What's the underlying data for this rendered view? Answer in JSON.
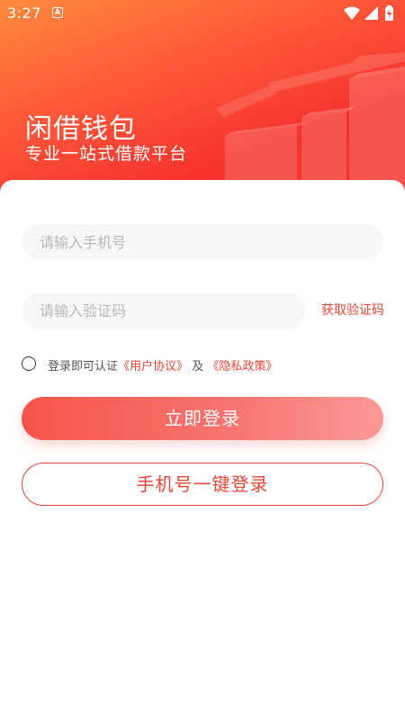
{
  "status_bar": {
    "time": "3:27",
    "notification_icon": "a-notification-icon",
    "wifi_icon": "wifi-icon",
    "signal_icon": "signal-icon",
    "battery_icon": "battery-icon"
  },
  "header": {
    "title": "闲借钱包",
    "subtitle": "专业一站式借款平台"
  },
  "form": {
    "phone_placeholder": "请输入手机号",
    "phone_value": "",
    "code_placeholder": "请输入验证码",
    "code_value": "",
    "get_code_label": "获取验证码"
  },
  "agreement": {
    "checked": false,
    "prefix": "登录即可认证",
    "user_agreement": "《用户协议》",
    "conjunction": "及",
    "privacy_policy": "《隐私政策》"
  },
  "buttons": {
    "login": "立即登录",
    "one_click_login": "手机号一键登录"
  },
  "colors": {
    "accent": "#e8473a",
    "hero_gradient_start": "#ff8a3c",
    "hero_gradient_end": "#f2362c"
  }
}
